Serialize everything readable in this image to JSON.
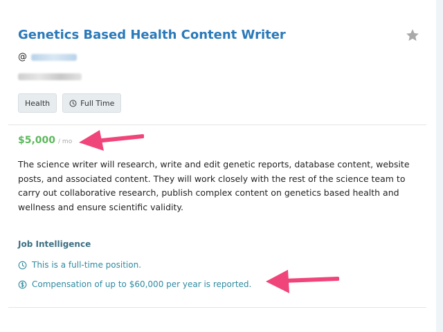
{
  "job": {
    "title": "Genetics Based Health Content Writer",
    "company_prefix": "@",
    "tags": [
      {
        "label": "Health",
        "icon": ""
      },
      {
        "label": "Full Time",
        "icon": "clock-icon"
      }
    ],
    "salary": {
      "amount": "$5,000",
      "unit": "/ mo"
    },
    "description": "The science writer will research, write and edit genetic reports, database content, website posts, and associated content. They will work closely with the rest of the science team to carry out collaborative research, publish complex content on genetics based health and wellness and ensure scientific validity."
  },
  "job_intelligence": {
    "heading": "Job Intelligence",
    "items": [
      {
        "text": "This is a full-time position.",
        "icon": "clock-icon"
      },
      {
        "text": "Compensation of up to $60,000 per year is reported.",
        "icon": "dollar-circle-icon"
      }
    ]
  },
  "colors": {
    "title": "#2a79b9",
    "salary": "#5cb85c",
    "intelligence": "#2f8aa0",
    "arrow": "#f0457a"
  }
}
